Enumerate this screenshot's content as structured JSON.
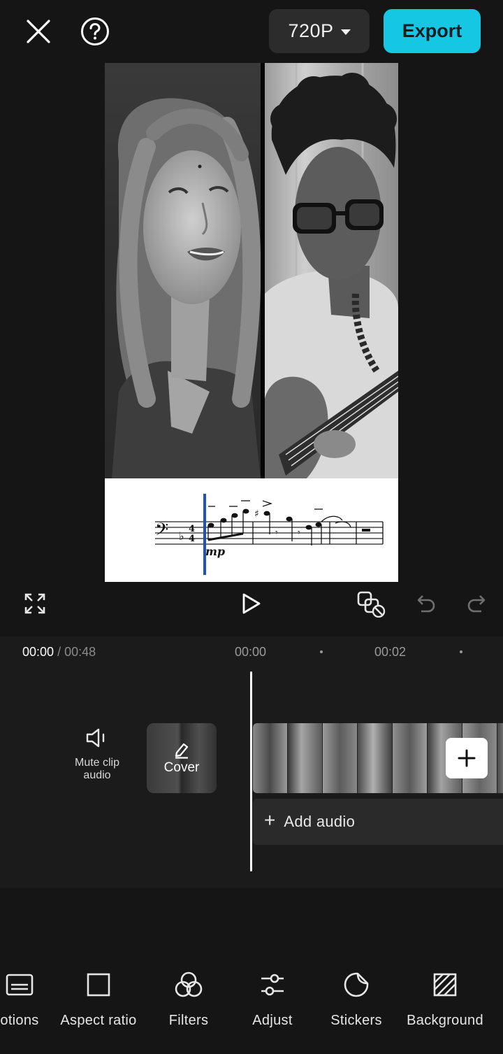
{
  "topbar": {
    "resolution": "720P",
    "export_label": "Export"
  },
  "preview": {
    "score_dynamic": "mp"
  },
  "timeline": {
    "current_time": "00:00",
    "total_time": "/ 00:48",
    "ruler_marks": [
      "00:00",
      "00:02"
    ],
    "mute_label_line1": "Mute clip",
    "mute_label_line2": "audio",
    "cover_label": "Cover",
    "add_audio_label": "Add audio"
  },
  "toolbar": {
    "items": [
      {
        "label": "otions",
        "icon": "captions-icon"
      },
      {
        "label": "Aspect ratio",
        "icon": "aspect-ratio-icon"
      },
      {
        "label": "Filters",
        "icon": "filters-icon"
      },
      {
        "label": "Adjust",
        "icon": "adjust-icon"
      },
      {
        "label": "Stickers",
        "icon": "stickers-icon"
      },
      {
        "label": "Background",
        "icon": "background-icon"
      }
    ]
  },
  "colors": {
    "background": "#151515",
    "accent": "#16c7e3",
    "panel": "#2c2c2c",
    "score_marker": "#1f56b5"
  }
}
